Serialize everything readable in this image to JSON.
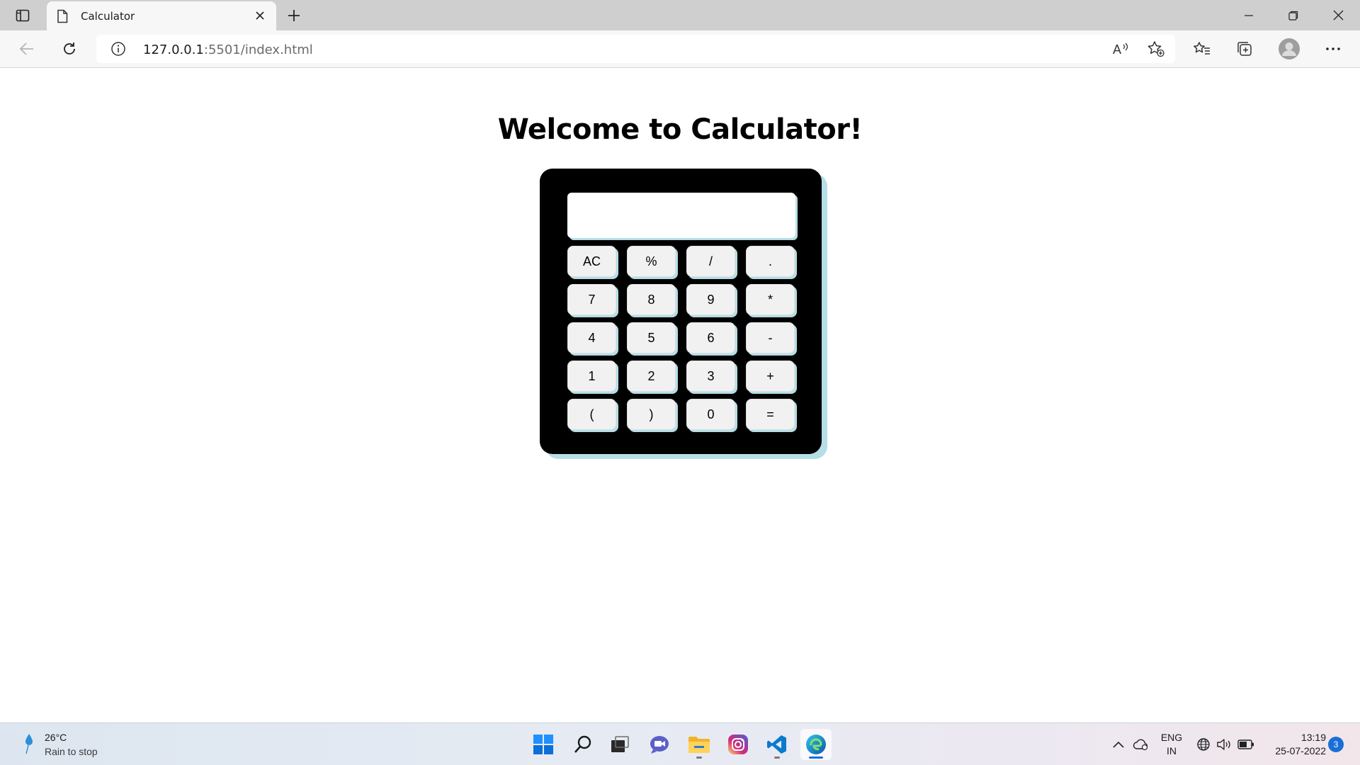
{
  "browser": {
    "tab_title": "Calculator",
    "url_host": "127.0.0.1",
    "url_rest": ":5501/index.html"
  },
  "page": {
    "heading": "Welcome to Calculator!",
    "display_value": "",
    "keys": [
      [
        "AC",
        "%",
        "/",
        "."
      ],
      [
        "7",
        "8",
        "9",
        "*"
      ],
      [
        "4",
        "5",
        "6",
        "-"
      ],
      [
        "1",
        "2",
        "3",
        "+"
      ],
      [
        "(",
        ")",
        "0",
        "="
      ]
    ]
  },
  "taskbar": {
    "weather_temp": "26°C",
    "weather_desc": "Rain to stop",
    "language_top": "ENG",
    "language_bottom": "IN",
    "time": "13:19",
    "date": "25-07-2022",
    "notification_count": "3",
    "apps": [
      "windows-start",
      "search",
      "task-view",
      "teams-chat",
      "file-explorer",
      "instagram",
      "vscode",
      "edge"
    ]
  },
  "colors": {
    "calc_body": "#000000",
    "calc_shadow": "#b6dee6",
    "key_bg": "#f1f1f1",
    "tabstrip": "#cfcfcf",
    "accent": "#1a6fd6"
  }
}
